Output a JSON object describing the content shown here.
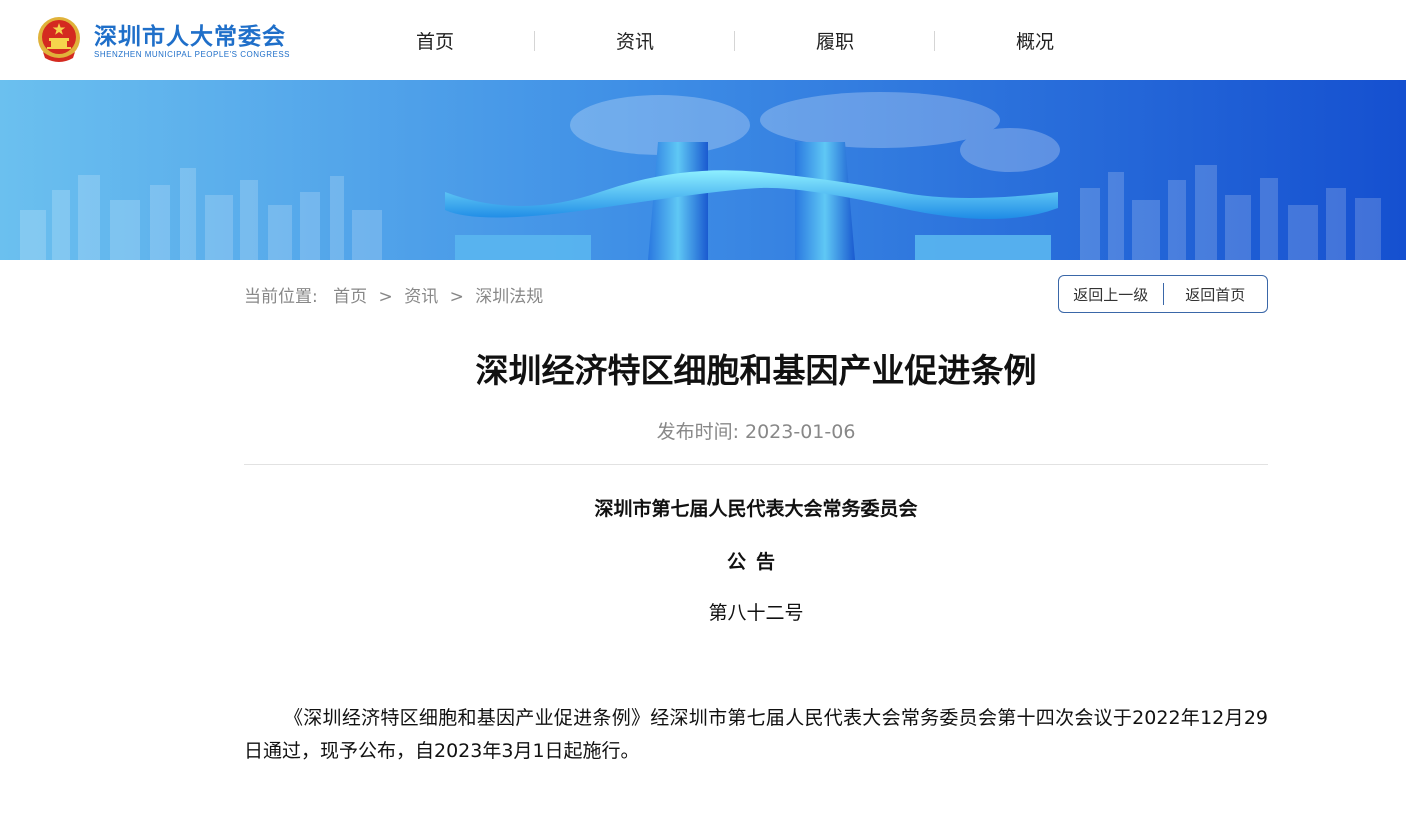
{
  "header": {
    "brand_cn": "深圳市人大常委会",
    "brand_en": "SHENZHEN MUNICIPAL PEOPLE'S CONGRESS",
    "nav": [
      "首页",
      "资讯",
      "履职",
      "概况"
    ]
  },
  "breadcrumb": {
    "label": "当前位置:",
    "items": [
      "首页",
      "资讯",
      "深圳法规"
    ],
    "separator": ">"
  },
  "actions": {
    "back": "返回上一级",
    "home": "返回首页"
  },
  "article": {
    "title": "深圳经济特区细胞和基因产业促进条例",
    "pubdate": "发布时间: 2023-01-06",
    "issuer": "深圳市第七届人民代表大会常务委员会",
    "notice": "公告",
    "number": "第八十二号",
    "body": "《深圳经济特区细胞和基因产业促进条例》经深圳市第七届人民代表大会常务委员会第十四次会议于2022年12月29日通过，现予公布，自2023年3月1日起施行。"
  },
  "colors": {
    "brand_blue": "#1f6fc9",
    "banner_blue": "#1d63d8",
    "button_border": "#3a67a8"
  }
}
